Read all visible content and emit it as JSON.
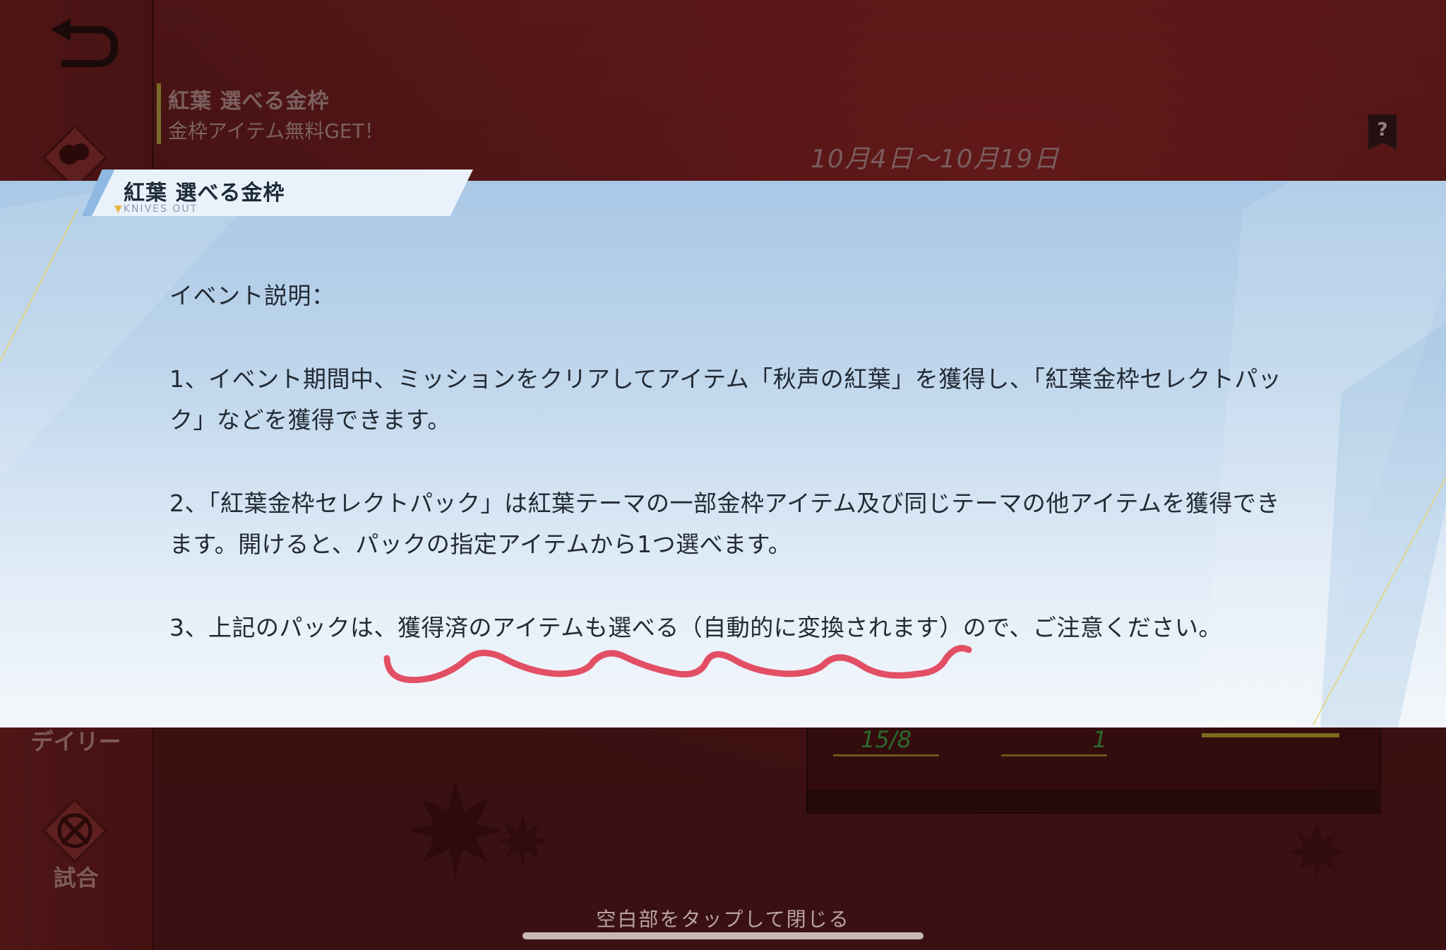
{
  "sidebar": {
    "items": [
      {
        "label": "デイリー",
        "icon": "balloon-icon"
      },
      {
        "label": "試合",
        "icon": "crossed-swords-icon"
      }
    ]
  },
  "header": {
    "event_title": "紅葉 選べる金枠",
    "event_subtitle": "金枠アイテム無料GET！",
    "period": "10月4日〜10月19日"
  },
  "bottom_panel": {
    "slot1_value": "15/8",
    "slot2_value": "1"
  },
  "modal": {
    "tab_title": "紅葉 選べる金枠",
    "brand": "KNIVES OUT",
    "heading": "イベント説明：",
    "items": [
      "1、イベント期間中、ミッションをクリアしてアイテム「秋声の紅葉」を獲得し、「紅葉金枠セレクトパック」などを獲得できます。",
      "2、「紅葉金枠セレクトパック」は紅葉テーマの一部金枠アイテム及び同じテーマの他アイテムを獲得できます。開けると、パックの指定アイテムから1つ選べます。",
      "3、上記のパックは、獲得済のアイテムも選べる（自動的に変換されます）ので、ご注意ください。"
    ]
  },
  "close_hint": "空白部をタップして閉じる",
  "colors": {
    "background": "#4a1414",
    "modal_top": "#a9c8e6",
    "modal_bottom": "#f3f7fb",
    "annotation": "#e0314a"
  }
}
